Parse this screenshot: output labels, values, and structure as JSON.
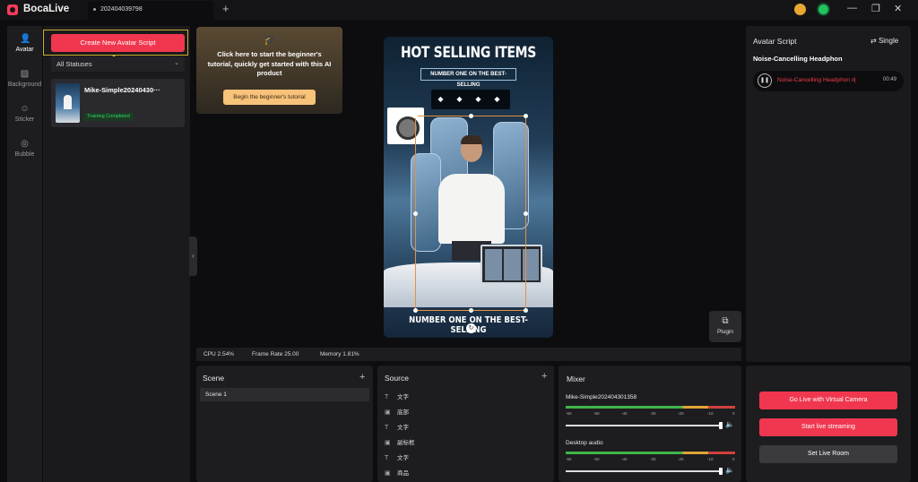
{
  "app": {
    "name": "BocaLive"
  },
  "tabs": [
    {
      "label": "202404039798"
    }
  ],
  "rail": [
    {
      "label": "Avatar",
      "icon": "person-icon",
      "active": true
    },
    {
      "label": "Background",
      "icon": "background-icon",
      "active": false
    },
    {
      "label": "Sticker",
      "icon": "sticker-icon",
      "active": false
    },
    {
      "label": "Bubble",
      "icon": "bubble-icon",
      "active": false
    }
  ],
  "avatar_panel": {
    "create_button": "Create New Avatar Script",
    "annotation": "1",
    "status_filter": "All Statuses",
    "cards": [
      {
        "name": "Mike-Simple20240430···",
        "status": "Training Completed"
      }
    ]
  },
  "tutorial": {
    "text": "Click here to start the beginner's tutorial, quickly get started with this AI product",
    "button": "Begin the beginner's tutorial"
  },
  "preview": {
    "title": "HOT SELLING ITEMS",
    "subtitle": "NUMBER ONE ON THE BEST-SELLING",
    "bottom_text": "NUMBER ONE ON THE BEST-SELLING"
  },
  "plugin": {
    "label": "Plugin"
  },
  "stats": {
    "cpu": "CPU 2.54%",
    "frame_rate": "Frame Rate 25.00",
    "memory": "Memory 1.81%"
  },
  "script_panel": {
    "title": "Avatar Script",
    "mode": "Single",
    "script_name": "Noise-Cancelling Headphon",
    "player": {
      "title": "Noise-Cancelling Headphon",
      "time": "00:49"
    }
  },
  "scene": {
    "title": "Scene",
    "items": [
      "Scene 1"
    ]
  },
  "source": {
    "title": "Source",
    "items": [
      {
        "icon": "text-icon",
        "label": "文字"
      },
      {
        "icon": "image-icon",
        "label": "底部"
      },
      {
        "icon": "text-icon",
        "label": "文字"
      },
      {
        "icon": "image-icon",
        "label": "副标框"
      },
      {
        "icon": "text-icon",
        "label": "文字"
      },
      {
        "icon": "image-icon",
        "label": "商品"
      }
    ]
  },
  "mixer": {
    "title": "Mixer",
    "ticks": [
      "-60",
      "-50",
      "-40",
      "-30",
      "-20",
      "-10",
      "0"
    ],
    "channels": [
      {
        "name": "Mike-Simple202404301358",
        "volume": 1.0
      },
      {
        "name": "Desktop audio",
        "volume": 1.0
      }
    ]
  },
  "live": {
    "virtual_camera": "Go Live with Virtual Camera",
    "start_streaming": "Start live streaming",
    "set_room": "Set Live Room"
  },
  "colors": {
    "accent": "#f0374f",
    "success": "#38d468",
    "annotation": "#f3e437"
  }
}
